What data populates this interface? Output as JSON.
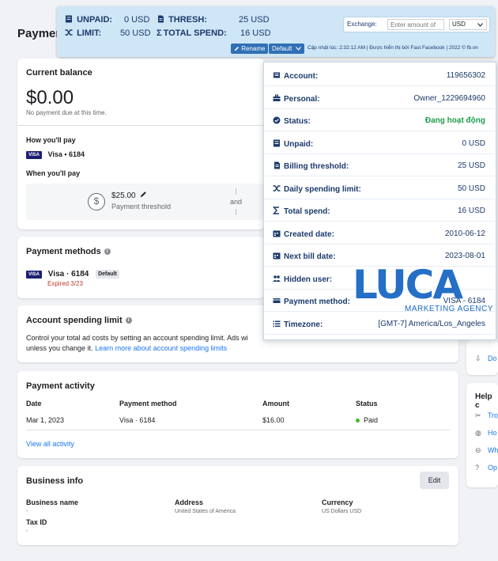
{
  "page": {
    "title": "Paymen"
  },
  "extension": {
    "unpaid_label": "UNPAID:",
    "unpaid_value": "0 USD",
    "thresh_label": "THRESH:",
    "thresh_value": "25 USD",
    "limit_label": "LIMIT:",
    "limit_value": "50 USD",
    "total_spend_label": "TOTAL SPEND:",
    "total_spend_value": "16 USD",
    "exchange_label": "Exchange:",
    "exchange_placeholder": "Enter amount of",
    "currency": "USD",
    "rename_label": "Rename",
    "default_label": "Default",
    "footer": "Cập nhật lúc: 2:32:12 AM | Được hiển thị bởi Fast Facebook | 2022 © fb.vn"
  },
  "popover": {
    "rows": [
      {
        "key": "Account:",
        "value": "119656302",
        "icon": "id-card-icon"
      },
      {
        "key": "Personal:",
        "value": "Owner_1229694960",
        "icon": "briefcase-icon"
      },
      {
        "key": "Status:",
        "value": "Đang hoạt động",
        "icon": "check-circle-icon"
      },
      {
        "key": "Unpaid:",
        "value": "0 USD",
        "icon": "receipt-icon"
      },
      {
        "key": "Billing threshold:",
        "value": "25 USD",
        "icon": "bill-icon"
      },
      {
        "key": "Daily spending limit:",
        "value": "50 USD",
        "icon": "shuffle-icon"
      },
      {
        "key": "Total spend:",
        "value": "16 USD",
        "icon": "sigma-icon"
      },
      {
        "key": "Created date:",
        "value": "2010-06-12",
        "icon": "calendar-icon"
      },
      {
        "key": "Next bill date:",
        "value": "2023-08-01",
        "icon": "calendar-icon"
      },
      {
        "key": "Hidden user:",
        "value": "",
        "icon": "users-icon"
      },
      {
        "key": "Payment method:",
        "value": "VISA - 6184",
        "icon": "card-icon"
      },
      {
        "key": "Timezone:",
        "value": "[GMT-7] America/Los_Angeles",
        "icon": "list-icon"
      }
    ]
  },
  "logo": {
    "letters": "LUCA",
    "subtitle": "MARKETING AGENCY"
  },
  "balance": {
    "title": "Current balance",
    "amount": "$0.00",
    "no_due": "No payment due at this time.",
    "how_pay": "How you'll pay",
    "visa_badge": "VISA",
    "visa_card": "Visa • 6184",
    "when_pay": "When you'll pay",
    "threshold_amount": "$25.00",
    "threshold_label": "Payment threshold",
    "and_text": "and"
  },
  "methods": {
    "title": "Payment methods",
    "visa_badge": "VISA",
    "card": "Visa · 6184",
    "default_badge": "Default",
    "expired": "Expired 3/23"
  },
  "limit": {
    "title": "Account spending limit",
    "text": "Control your total ad costs by setting an account spending limit. Ads wi",
    "text2": "unless you change it.",
    "link": "Learn more about account spending limits"
  },
  "activity": {
    "title": "Payment activity",
    "headers": [
      "Date",
      "Payment method",
      "Amount",
      "Status"
    ],
    "row": [
      "Mar 1, 2023",
      "Visa · 6184",
      "$16.00",
      "Paid"
    ],
    "view_all": "View all activity"
  },
  "business": {
    "title": "Business info",
    "edit": "Edit",
    "name_label": "Business name",
    "name_value": "-",
    "address_label": "Address",
    "address_value": "United States of America",
    "currency_label": "Currency",
    "currency_value": "US Dollars USD",
    "tax_label": "Tax ID",
    "tax_value": "-"
  },
  "right_panel": {
    "download_text": "Do",
    "help_title": "Help c",
    "help_items": [
      "Tro",
      "Ho",
      "Wh",
      "Op"
    ]
  },
  "colors": {
    "accent": "#1877f2",
    "extension_bg": "#cfe6f7",
    "extension_text": "#1b3a6b",
    "status_green": "#1e9e4a",
    "logo_blue": "#1a68c4"
  }
}
